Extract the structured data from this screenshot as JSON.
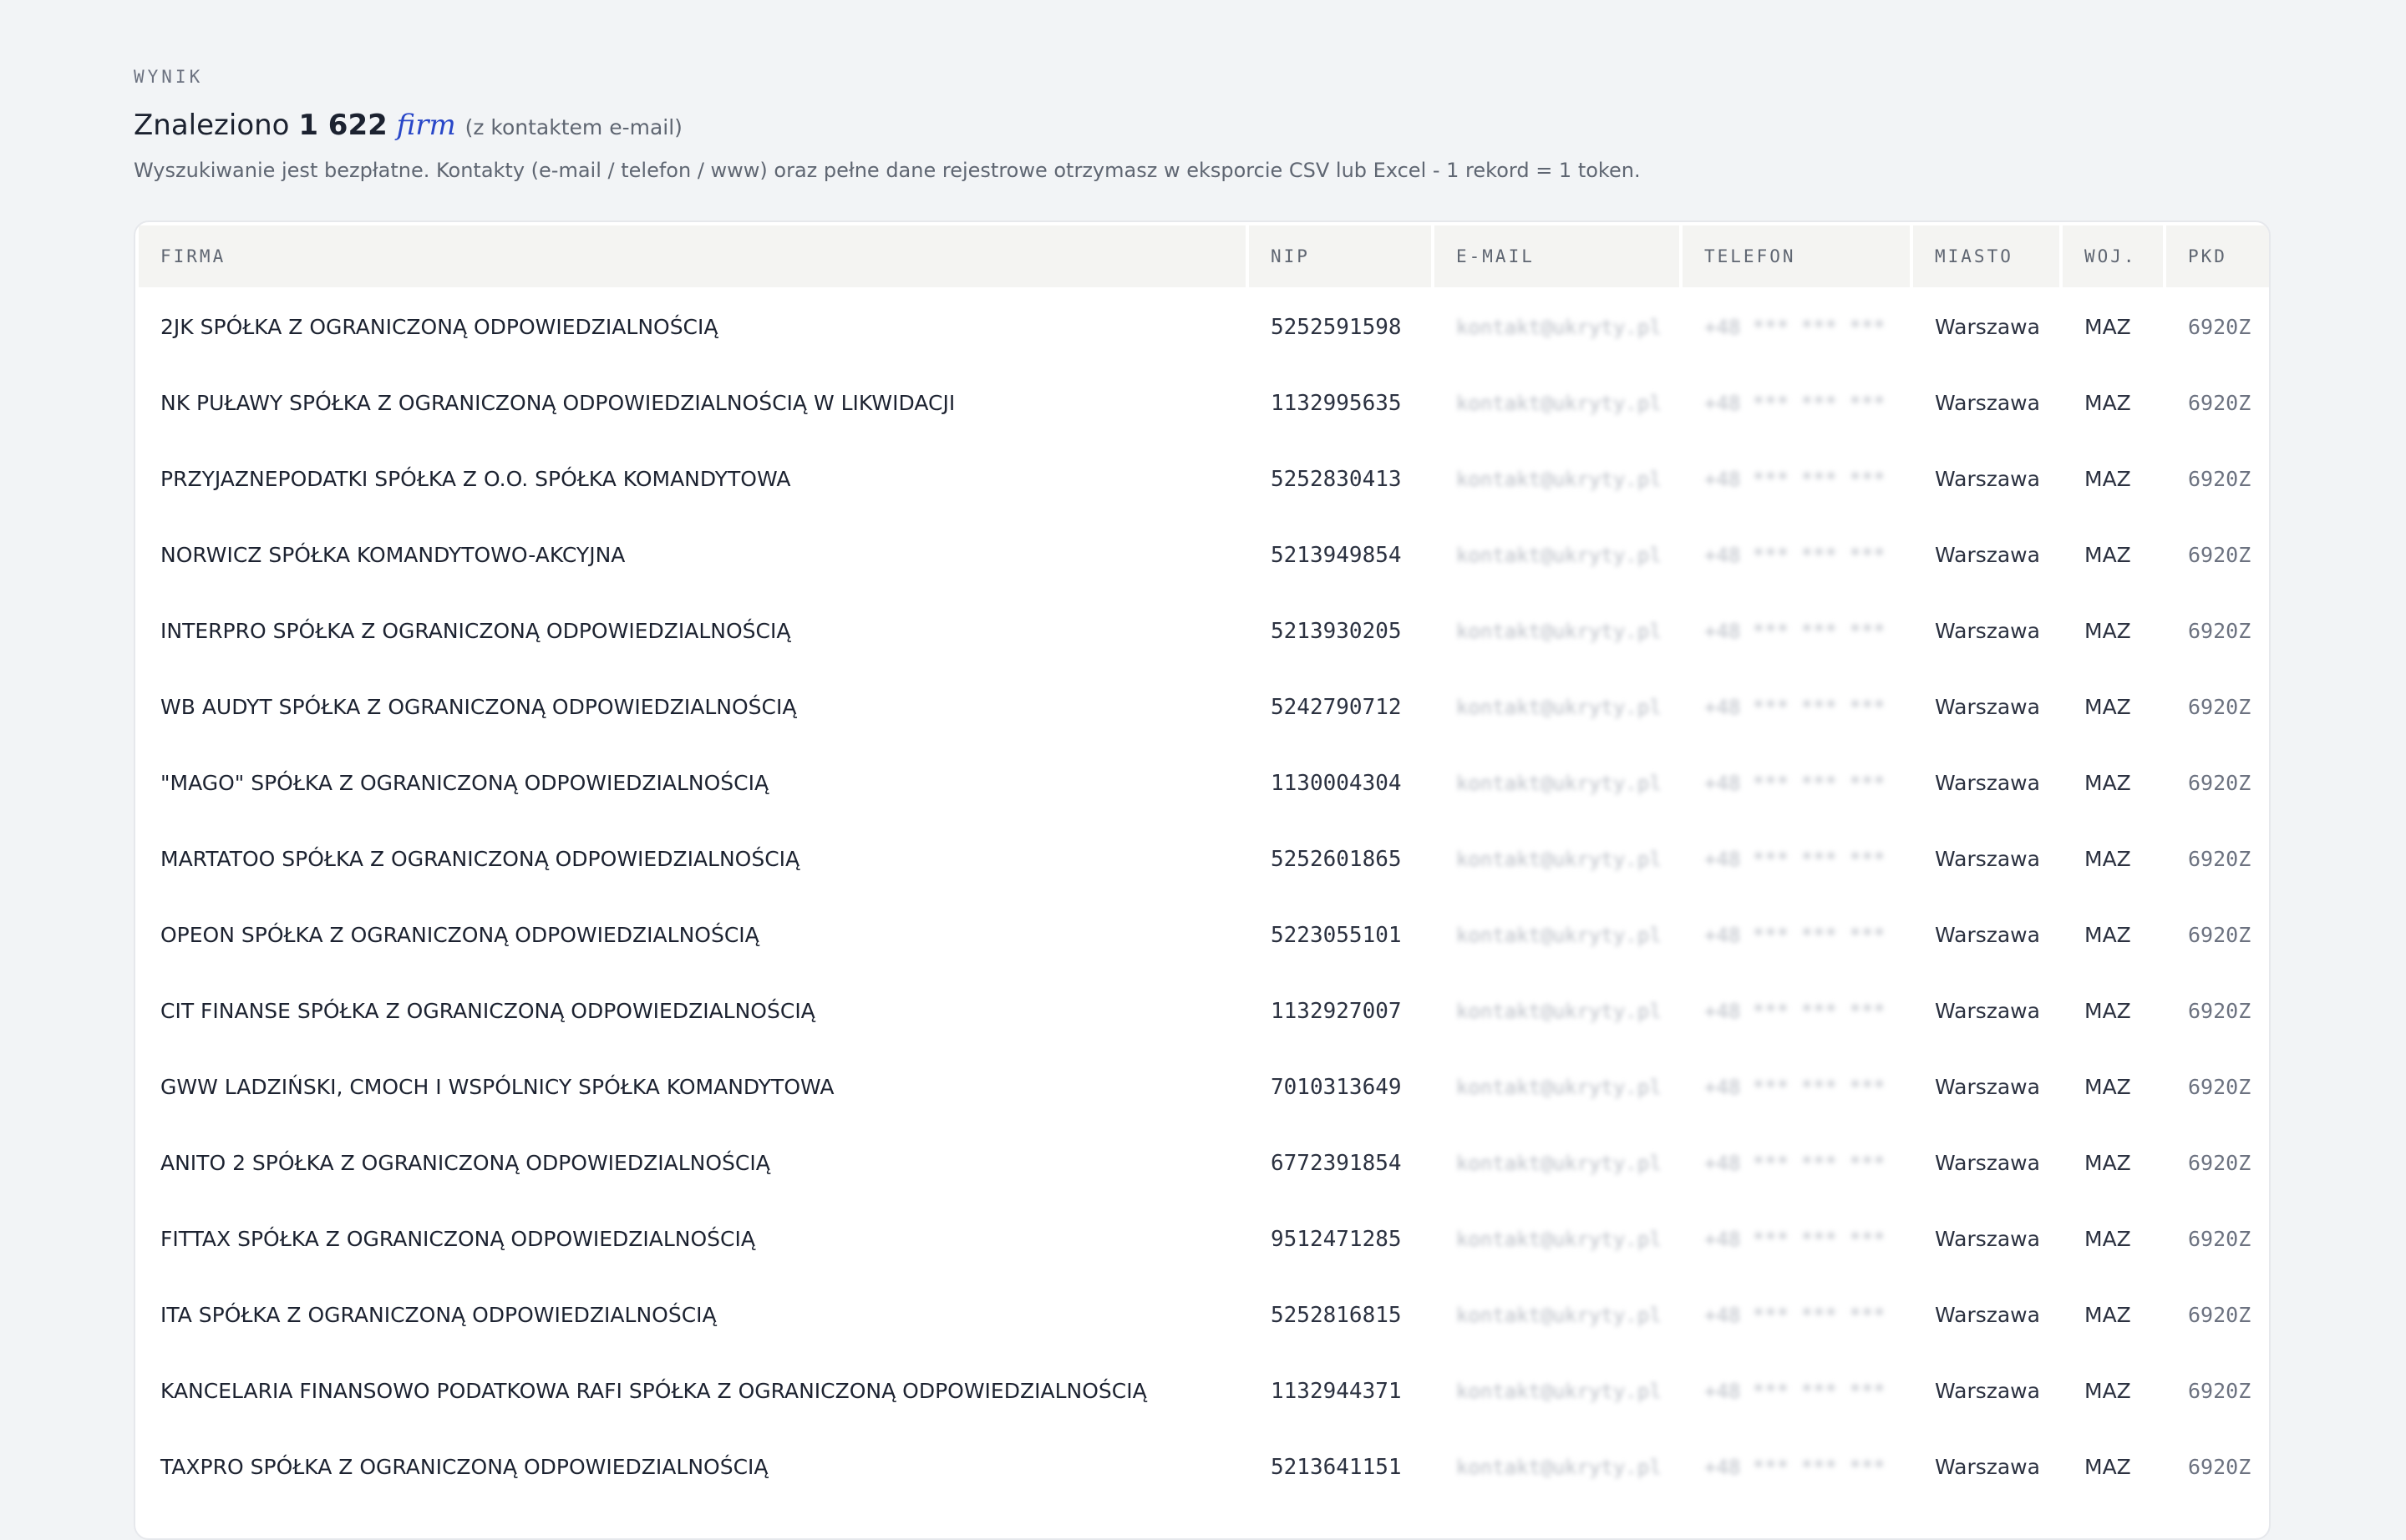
{
  "header": {
    "eyebrow": "WYNIK",
    "found_prefix": "Znaleziono",
    "count": "1 622",
    "unit": "firm",
    "note": "(z kontaktem e-mail)",
    "subtitle": "Wyszukiwanie jest bezpłatne. Kontakty (e-mail / telefon / www) oraz pełne dane rejestrowe otrzymasz w eksporcie CSV lub Excel - 1 rekord = 1 token."
  },
  "table": {
    "columns": [
      "FIRMA",
      "NIP",
      "E-MAIL",
      "TELEFON",
      "MIASTO",
      "WOJ.",
      "PKD"
    ],
    "rows": [
      {
        "firma": "2JK SPÓŁKA Z OGRANICZONĄ ODPOWIEDZIALNOŚCIĄ",
        "nip": "5252591598",
        "email": "kontakt@ukryty.pl",
        "telefon": "+48 *** *** ***",
        "miasto": "Warszawa",
        "woj": "MAZ",
        "pkd": "6920Z"
      },
      {
        "firma": "NK PUŁAWY SPÓŁKA Z OGRANICZONĄ ODPOWIEDZIALNOŚCIĄ W LIKWIDACJI",
        "nip": "1132995635",
        "email": "kontakt@ukryty.pl",
        "telefon": "+48 *** *** ***",
        "miasto": "Warszawa",
        "woj": "MAZ",
        "pkd": "6920Z"
      },
      {
        "firma": "PRZYJAZNEPODATKI SPÓŁKA Z O.O. SPÓŁKA KOMANDYTOWA",
        "nip": "5252830413",
        "email": "kontakt@ukryty.pl",
        "telefon": "+48 *** *** ***",
        "miasto": "Warszawa",
        "woj": "MAZ",
        "pkd": "6920Z"
      },
      {
        "firma": "NORWICZ SPÓŁKA KOMANDYTOWO-AKCYJNA",
        "nip": "5213949854",
        "email": "kontakt@ukryty.pl",
        "telefon": "+48 *** *** ***",
        "miasto": "Warszawa",
        "woj": "MAZ",
        "pkd": "6920Z"
      },
      {
        "firma": "INTERPRO SPÓŁKA Z OGRANICZONĄ ODPOWIEDZIALNOŚCIĄ",
        "nip": "5213930205",
        "email": "kontakt@ukryty.pl",
        "telefon": "+48 *** *** ***",
        "miasto": "Warszawa",
        "woj": "MAZ",
        "pkd": "6920Z"
      },
      {
        "firma": "WB AUDYT SPÓŁKA Z OGRANICZONĄ ODPOWIEDZIALNOŚCIĄ",
        "nip": "5242790712",
        "email": "kontakt@ukryty.pl",
        "telefon": "+48 *** *** ***",
        "miasto": "Warszawa",
        "woj": "MAZ",
        "pkd": "6920Z"
      },
      {
        "firma": "\"MAGO\" SPÓŁKA Z OGRANICZONĄ ODPOWIEDZIALNOŚCIĄ",
        "nip": "1130004304",
        "email": "kontakt@ukryty.pl",
        "telefon": "+48 *** *** ***",
        "miasto": "Warszawa",
        "woj": "MAZ",
        "pkd": "6920Z"
      },
      {
        "firma": "MARTATOO SPÓŁKA Z OGRANICZONĄ ODPOWIEDZIALNOŚCIĄ",
        "nip": "5252601865",
        "email": "kontakt@ukryty.pl",
        "telefon": "+48 *** *** ***",
        "miasto": "Warszawa",
        "woj": "MAZ",
        "pkd": "6920Z"
      },
      {
        "firma": "OPEON SPÓŁKA Z OGRANICZONĄ ODPOWIEDZIALNOŚCIĄ",
        "nip": "5223055101",
        "email": "kontakt@ukryty.pl",
        "telefon": "+48 *** *** ***",
        "miasto": "Warszawa",
        "woj": "MAZ",
        "pkd": "6920Z"
      },
      {
        "firma": "CIT FINANSE SPÓŁKA Z OGRANICZONĄ ODPOWIEDZIALNOŚCIĄ",
        "nip": "1132927007",
        "email": "kontakt@ukryty.pl",
        "telefon": "+48 *** *** ***",
        "miasto": "Warszawa",
        "woj": "MAZ",
        "pkd": "6920Z"
      },
      {
        "firma": "GWW LADZIŃSKI, CMOCH I WSPÓLNICY SPÓŁKA KOMANDYTOWA",
        "nip": "7010313649",
        "email": "kontakt@ukryty.pl",
        "telefon": "+48 *** *** ***",
        "miasto": "Warszawa",
        "woj": "MAZ",
        "pkd": "6920Z"
      },
      {
        "firma": "ANITO 2 SPÓŁKA Z OGRANICZONĄ ODPOWIEDZIALNOŚCIĄ",
        "nip": "6772391854",
        "email": "kontakt@ukryty.pl",
        "telefon": "+48 *** *** ***",
        "miasto": "Warszawa",
        "woj": "MAZ",
        "pkd": "6920Z"
      },
      {
        "firma": "FITTAX SPÓŁKA Z OGRANICZONĄ ODPOWIEDZIALNOŚCIĄ",
        "nip": "9512471285",
        "email": "kontakt@ukryty.pl",
        "telefon": "+48 *** *** ***",
        "miasto": "Warszawa",
        "woj": "MAZ",
        "pkd": "6920Z"
      },
      {
        "firma": "ITA SPÓŁKA Z OGRANICZONĄ ODPOWIEDZIALNOŚCIĄ",
        "nip": "5252816815",
        "email": "kontakt@ukryty.pl",
        "telefon": "+48 *** *** ***",
        "miasto": "Warszawa",
        "woj": "MAZ",
        "pkd": "6920Z"
      },
      {
        "firma": "KANCELARIA FINANSOWO PODATKOWA RAFI SPÓŁKA Z OGRANICZONĄ ODPOWIEDZIALNOŚCIĄ",
        "nip": "1132944371",
        "email": "kontakt@ukryty.pl",
        "telefon": "+48 *** *** ***",
        "miasto": "Warszawa",
        "woj": "MAZ",
        "pkd": "6920Z"
      },
      {
        "firma": "TAXPRO SPÓŁKA Z OGRANICZONĄ ODPOWIEDZIALNOŚCIĄ",
        "nip": "5213641151",
        "email": "kontakt@ukryty.pl",
        "telefon": "+48 *** *** ***",
        "miasto": "Warszawa",
        "woj": "MAZ",
        "pkd": "6920Z"
      }
    ]
  }
}
